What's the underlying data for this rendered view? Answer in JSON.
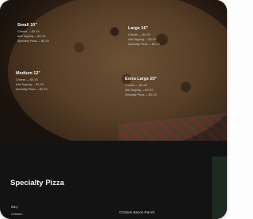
{
  "menu_card": {
    "blocks": [
      {
        "title": "Small 10\"",
        "lines": [
          "Cheese — $X.XX",
          "Add Topping — $X.XX",
          "Specialty Pizza — $X.XX"
        ]
      },
      {
        "title": "Large 16\"",
        "lines": [
          "Cheese — $X.XX",
          "Add Topping — $X.XX",
          "Specialty Pizza — $X.XX"
        ]
      },
      {
        "title": "Medium 12\"",
        "lines": [
          "Cheese — $X.XX",
          "Add Topping — $X.XX",
          "Specialty Pizza — $X.XX"
        ]
      },
      {
        "title": "Extra Large 20\"",
        "lines": [
          "Cheese — $X.XX",
          "Add Topping — $X.XX",
          "Specialty Pizza — $X.XX"
        ]
      }
    ],
    "section_title": "Specialty Pizza",
    "footer_left": "BBQ",
    "footer_left_2": "Chicken",
    "footer_right": "Chicken Bacon Ranch"
  }
}
